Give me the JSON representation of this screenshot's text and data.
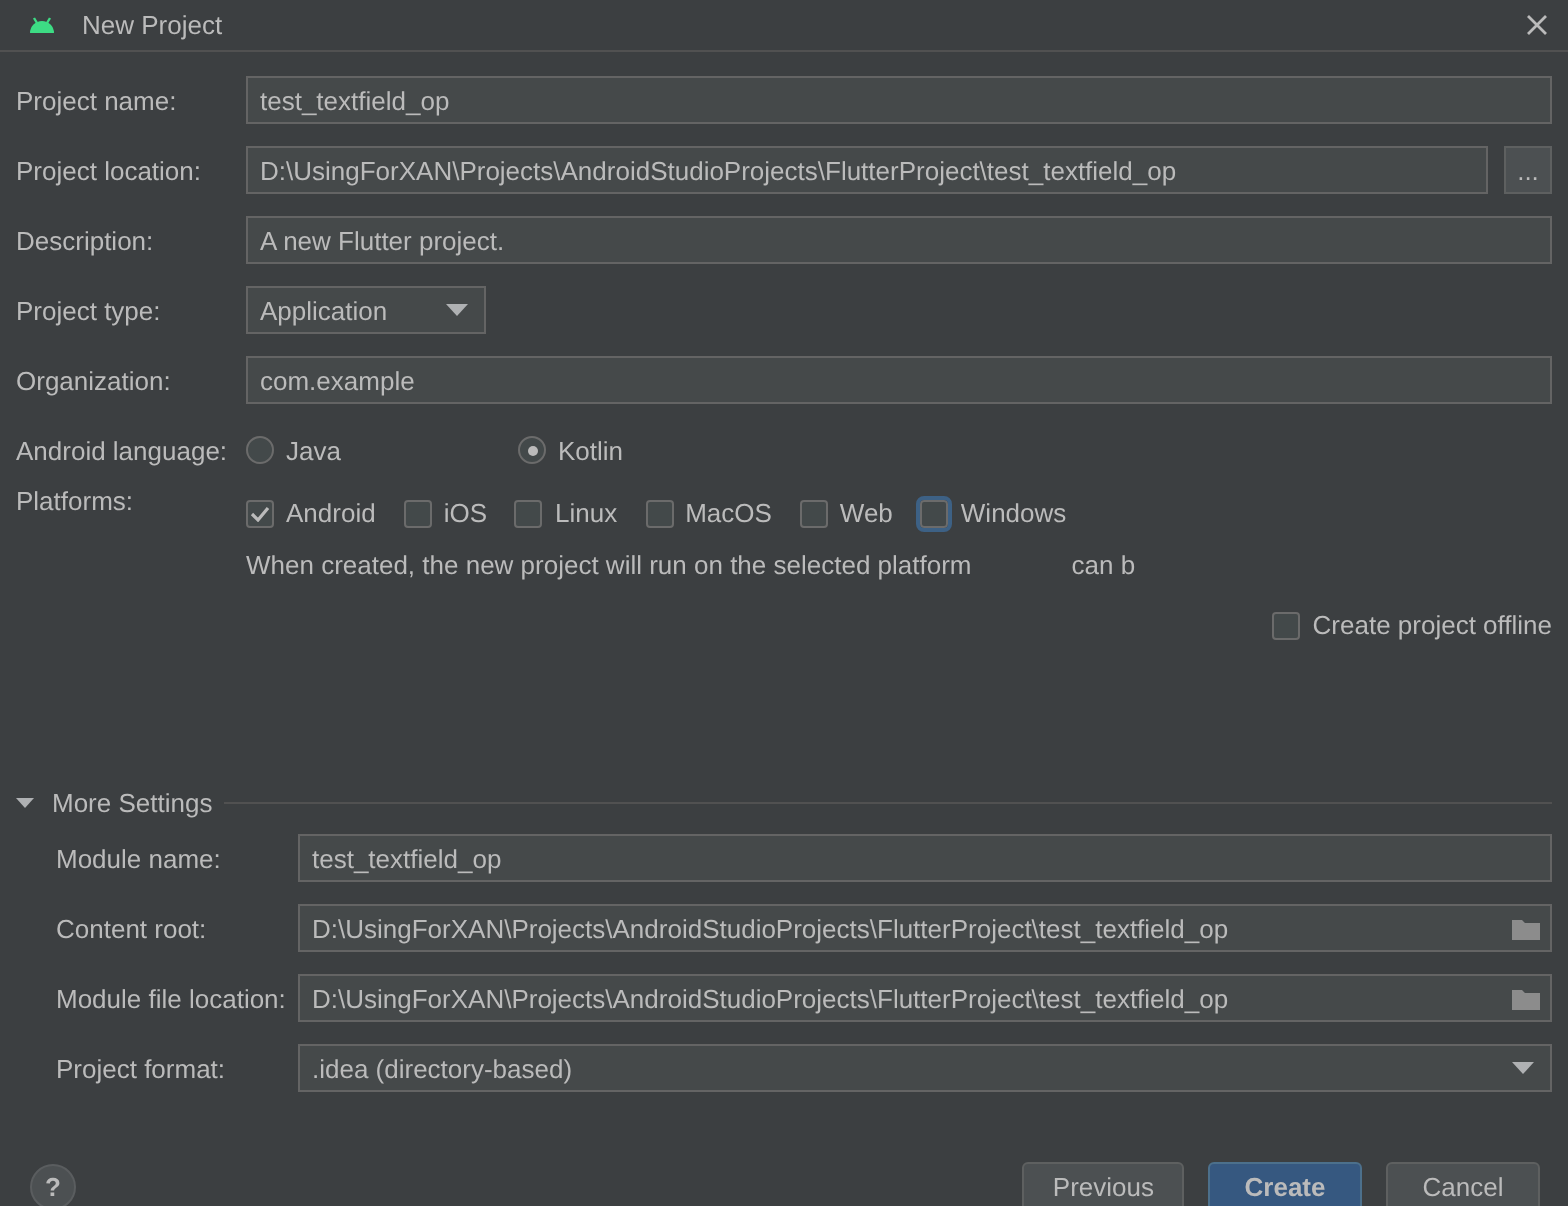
{
  "window": {
    "title": "New Project"
  },
  "fields": [
    {
      "label": "Project name:",
      "kind": "text",
      "value": "test_textfield_op"
    },
    {
      "label": "Project location:",
      "kind": "browse",
      "value": "D:\\UsingForXAN\\Projects\\AndroidStudioProjects\\FlutterProject\\test_textfield_op",
      "button": "..."
    },
    {
      "label": "Description:",
      "kind": "text",
      "value": "A new Flutter project."
    },
    {
      "label": "Project type:",
      "kind": "dropdown",
      "value": "Application"
    },
    {
      "label": "Organization:",
      "kind": "text",
      "value": "com.example"
    }
  ],
  "android_language": {
    "label": "Android language:",
    "options": [
      {
        "label": "Java",
        "selected": false
      },
      {
        "label": "Kotlin",
        "selected": true
      }
    ]
  },
  "platforms": {
    "label": "Platforms:",
    "options": [
      {
        "label": "Android",
        "checked": true,
        "focused": false
      },
      {
        "label": "iOS",
        "checked": false,
        "focused": false
      },
      {
        "label": "Linux",
        "checked": false,
        "focused": false
      },
      {
        "label": "MacOS",
        "checked": false,
        "focused": false
      },
      {
        "label": "Web",
        "checked": false,
        "focused": false
      },
      {
        "label": "Windows",
        "checked": false,
        "focused": true
      }
    ],
    "note": "When created, the new project will run on the selected platform",
    "note_tail": "can b"
  },
  "offline": {
    "label": "Create project offline",
    "checked": false
  },
  "more_settings": {
    "title": "More Settings",
    "expanded": true,
    "fields": [
      {
        "label": "Module name:",
        "kind": "text",
        "value": "test_textfield_op"
      },
      {
        "label": "Content root:",
        "kind": "folder",
        "value": "D:\\UsingForXAN\\Projects\\AndroidStudioProjects\\FlutterProject\\test_textfield_op"
      },
      {
        "label": "Module file location:",
        "kind": "folder",
        "value": "D:\\UsingForXAN\\Projects\\AndroidStudioProjects\\FlutterProject\\test_textfield_op"
      },
      {
        "label": "Project format:",
        "kind": "dropdown_wide",
        "value": ".idea (directory-based)"
      }
    ]
  },
  "help": "?",
  "buttons": [
    {
      "label": "Previous",
      "kind": "default"
    },
    {
      "label": "Create",
      "kind": "primary"
    },
    {
      "label": "Cancel",
      "kind": "default"
    }
  ]
}
